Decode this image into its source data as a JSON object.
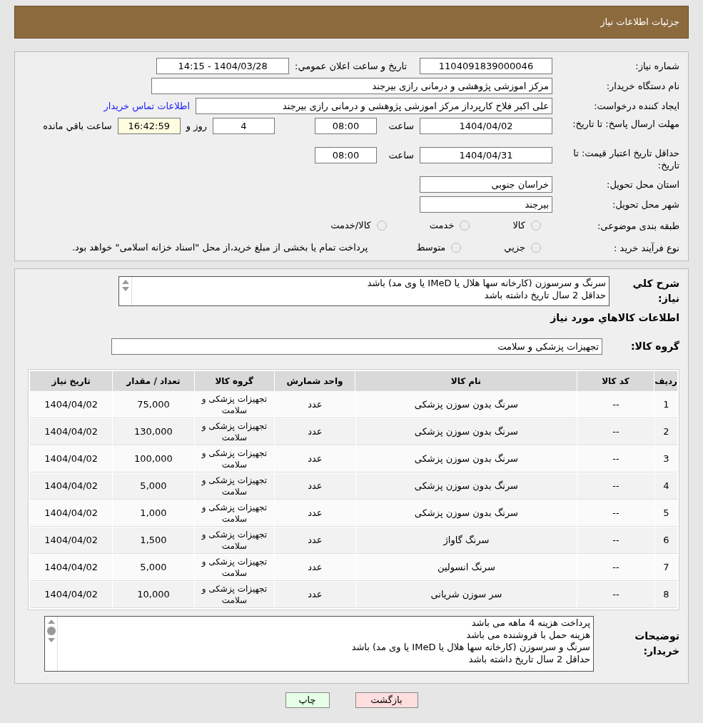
{
  "header": {
    "title": "جزئیات اطلاعات نیاز"
  },
  "info": {
    "need_number": {
      "label": "شماره نیاز:",
      "value": "1104091839000046"
    },
    "announce": {
      "label": "تاریخ و ساعت اعلان عمومي:",
      "value": "1404/03/28 - 14:15"
    },
    "buyer": {
      "label": "نام دستگاه خریدار:",
      "value": "مرکز اموزشی پژوهشی و درمانی رازی بیرجند"
    },
    "requester": {
      "label": "ایجاد کننده درخواست:",
      "value": "علی اکبر فلاح کارپرداز مرکز اموزشی پژوهشی و درمانی رازی بیرجند",
      "link": "اطلاعات تماس خریدار"
    },
    "deadline": {
      "label": "مهلت ارسال پاسخ: تا تاریخ:",
      "date": "1404/04/02",
      "time_label": "ساعت",
      "time": "08:00",
      "days": "4",
      "days_label": "روز و",
      "remaining": "16:42:59",
      "remaining_label": "ساعت باقي مانده"
    },
    "validity": {
      "label": "حداقل تاریخ اعتبار قیمت: تا تاریخ:",
      "date": "1404/04/31",
      "time_label": "ساعت",
      "time": "08:00"
    },
    "province": {
      "label": "استان محل تحویل:",
      "value": "خراسان جنوبی"
    },
    "city": {
      "label": "شهر محل تحویل:",
      "value": "بیرجند"
    },
    "category": {
      "label": "طبقه بندی موضوعی:",
      "options": [
        {
          "label": "کالا",
          "selected": false
        },
        {
          "label": "خدمت",
          "selected": false
        },
        {
          "label": "کالا/خدمت",
          "selected": false
        }
      ]
    },
    "process": {
      "label": "نوع فرآیند خرید :",
      "options": [
        {
          "label": "جزيي",
          "selected": false
        },
        {
          "label": "متوسط",
          "selected": false
        }
      ],
      "note": "پرداخت تمام یا بخشی از مبلغ خرید،از محل \"اسناد خزانه اسلامی\" خواهد بود."
    }
  },
  "description": {
    "label": "شرح کلي نیاز:",
    "lines": [
      "سرنگ و سرسوزن (کارخانه سها هلال یا IMeD یا وی مد) باشد",
      "حداقل 2 سال تاریخ داشته باشد"
    ]
  },
  "goods_heading": "اطلاعات کالاهاي مورد نیاز",
  "goods_group": {
    "label": "گروه کالا:",
    "value": "تجهیزات پزشکی و سلامت"
  },
  "table": {
    "columns": [
      "ردیف",
      "کد کالا",
      "نام کالا",
      "واحد شمارش",
      "گروه کالا",
      "تعداد / مقدار",
      "تاریخ نیاز"
    ],
    "rows": [
      [
        "1",
        "--",
        "سرنگ بدون سوزن پزشکی",
        "عدد",
        "تجهیزات پزشکی و سلامت",
        "75,000",
        "1404/04/02"
      ],
      [
        "2",
        "--",
        "سرنگ بدون سوزن پزشکی",
        "عدد",
        "تجهیزات پزشکی و سلامت",
        "130,000",
        "1404/04/02"
      ],
      [
        "3",
        "--",
        "سرنگ بدون سوزن پزشکی",
        "عدد",
        "تجهیزات پزشکی و سلامت",
        "100,000",
        "1404/04/02"
      ],
      [
        "4",
        "--",
        "سرنگ بدون سوزن پزشکی",
        "عدد",
        "تجهیزات پزشکی و سلامت",
        "5,000",
        "1404/04/02"
      ],
      [
        "5",
        "--",
        "سرنگ بدون سوزن پزشکی",
        "عدد",
        "تجهیزات پزشکی و سلامت",
        "1,000",
        "1404/04/02"
      ],
      [
        "6",
        "--",
        "سرنگ گاواژ",
        "عدد",
        "تجهیزات پزشکی و سلامت",
        "1,500",
        "1404/04/02"
      ],
      [
        "7",
        "--",
        "سرنگ انسولین",
        "عدد",
        "تجهیزات پزشکی و سلامت",
        "5,000",
        "1404/04/02"
      ],
      [
        "8",
        "--",
        "سر سوزن شریانی",
        "عدد",
        "تجهیزات پزشکی و سلامت",
        "10,000",
        "1404/04/02"
      ]
    ]
  },
  "buyer_notes": {
    "label": "توضیحات خریدار:",
    "lines": [
      "پرداخت هزینه 4 ماهه می باشد",
      "هزینه حمل با فروشنده می باشد",
      "سرنگ و سرسوزن (کارخانه سها هلال یا IMeD یا وی مد) باشد",
      "حداقل 2 سال تاریخ داشته باشد"
    ]
  },
  "buttons": {
    "back": "بازگشت",
    "print": "چاپ"
  }
}
